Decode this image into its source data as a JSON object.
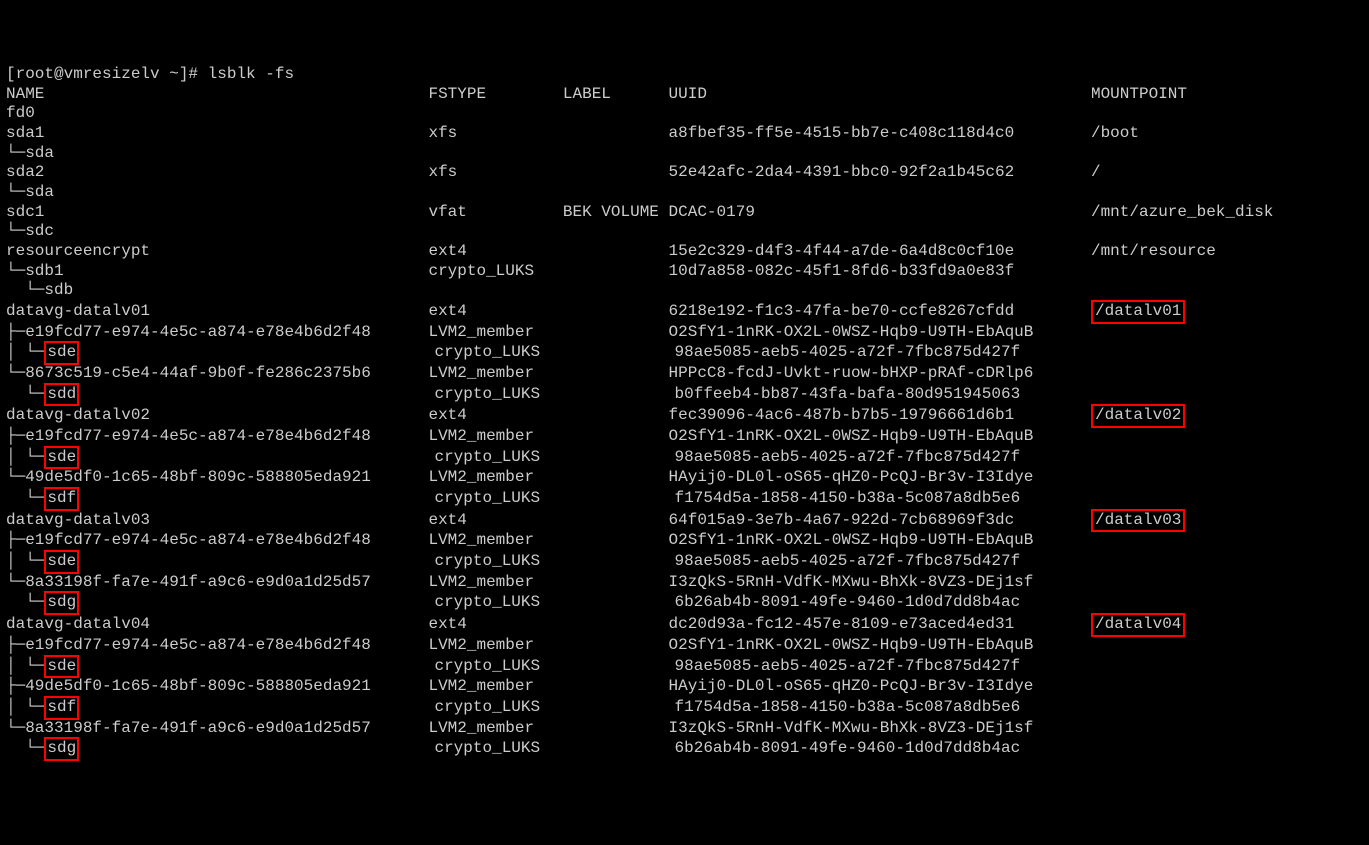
{
  "prompt": "[root@vmresizelv ~]# lsblk -fs",
  "hdr": {
    "name": "NAME",
    "fstype": "FSTYPE",
    "label": "LABEL",
    "uuid": "UUID",
    "mountpoint": "MOUNTPOINT"
  },
  "rows": [
    {
      "name": "fd0"
    },
    {
      "name": "sda1",
      "fstype": "xfs",
      "uuid": "a8fbef35-ff5e-4515-bb7e-c408c118d4c0",
      "mountpoint": "/boot"
    },
    {
      "name": "└─sda"
    },
    {
      "name": "sda2",
      "fstype": "xfs",
      "uuid": "52e42afc-2da4-4391-bbc0-92f2a1b45c62",
      "mountpoint": "/"
    },
    {
      "name": "└─sda"
    },
    {
      "name": "sdc1",
      "fstype": "vfat",
      "label": "BEK VOLUME",
      "uuid": "DCAC-0179",
      "mountpoint": "/mnt/azure_bek_disk"
    },
    {
      "name": "└─sdc"
    },
    {
      "name": "resourceencrypt",
      "fstype": "ext4",
      "uuid": "15e2c329-d4f3-4f44-a7de-6a4d8c0cf10e",
      "mountpoint": "/mnt/resource"
    },
    {
      "name": "└─sdb1",
      "fstype": "crypto_LUKS",
      "uuid": "10d7a858-082c-45f1-8fd6-b33fd9a0e83f"
    },
    {
      "name": "  └─sdb"
    },
    {
      "name": "datavg-datalv01",
      "fstype": "ext4",
      "uuid": "6218e192-f1c3-47fa-be70-ccfe8267cfdd",
      "mountpoint": "/datalv01",
      "hlmp": true
    },
    {
      "name": "├─e19fcd77-e974-4e5c-a874-e78e4b6d2f48",
      "fstype": "LVM2_member",
      "uuid": "O2SfY1-1nRK-OX2L-0WSZ-Hqb9-U9TH-EbAquB"
    },
    {
      "name": "│ └─sde",
      "fstype": "crypto_LUKS",
      "uuid": "98ae5085-aeb5-4025-a72f-7fbc875d427f",
      "hlname": "sde",
      "pre": "│ └─"
    },
    {
      "name": "└─8673c519-c5e4-44af-9b0f-fe286c2375b6",
      "fstype": "LVM2_member",
      "uuid": "HPPcC8-fcdJ-Uvkt-ruow-bHXP-pRAf-cDRlp6"
    },
    {
      "name": "  └─sdd",
      "fstype": "crypto_LUKS",
      "uuid": "b0ffeeb4-bb87-43fa-bafa-80d951945063",
      "hlname": "sdd",
      "pre": "  └─"
    },
    {
      "name": "datavg-datalv02",
      "fstype": "ext4",
      "uuid": "fec39096-4ac6-487b-b7b5-19796661d6b1",
      "mountpoint": "/datalv02",
      "hlmp": true
    },
    {
      "name": "├─e19fcd77-e974-4e5c-a874-e78e4b6d2f48",
      "fstype": "LVM2_member",
      "uuid": "O2SfY1-1nRK-OX2L-0WSZ-Hqb9-U9TH-EbAquB"
    },
    {
      "name": "│ └─sde",
      "fstype": "crypto_LUKS",
      "uuid": "98ae5085-aeb5-4025-a72f-7fbc875d427f",
      "hlname": "sde",
      "pre": "│ └─"
    },
    {
      "name": "└─49de5df0-1c65-48bf-809c-588805eda921",
      "fstype": "LVM2_member",
      "uuid": "HAyij0-DL0l-oS65-qHZ0-PcQJ-Br3v-I3Idye"
    },
    {
      "name": "  └─sdf",
      "fstype": "crypto_LUKS",
      "uuid": "f1754d5a-1858-4150-b38a-5c087a8db5e6",
      "hlname": "sdf",
      "pre": "  └─"
    },
    {
      "name": "datavg-datalv03",
      "fstype": "ext4",
      "uuid": "64f015a9-3e7b-4a67-922d-7cb68969f3dc",
      "mountpoint": "/datalv03",
      "hlmp": true
    },
    {
      "name": "├─e19fcd77-e974-4e5c-a874-e78e4b6d2f48",
      "fstype": "LVM2_member",
      "uuid": "O2SfY1-1nRK-OX2L-0WSZ-Hqb9-U9TH-EbAquB"
    },
    {
      "name": "│ └─sde",
      "fstype": "crypto_LUKS",
      "uuid": "98ae5085-aeb5-4025-a72f-7fbc875d427f",
      "hlname": "sde",
      "pre": "│ └─"
    },
    {
      "name": "└─8a33198f-fa7e-491f-a9c6-e9d0a1d25d57",
      "fstype": "LVM2_member",
      "uuid": "I3zQkS-5RnH-VdfK-MXwu-BhXk-8VZ3-DEj1sf"
    },
    {
      "name": "  └─sdg",
      "fstype": "crypto_LUKS",
      "uuid": "6b26ab4b-8091-49fe-9460-1d0d7dd8b4ac",
      "hlname": "sdg",
      "pre": "  └─"
    },
    {
      "name": "datavg-datalv04",
      "fstype": "ext4",
      "uuid": "dc20d93a-fc12-457e-8109-e73aced4ed31",
      "mountpoint": "/datalv04",
      "hlmp": true
    },
    {
      "name": "├─e19fcd77-e974-4e5c-a874-e78e4b6d2f48",
      "fstype": "LVM2_member",
      "uuid": "O2SfY1-1nRK-OX2L-0WSZ-Hqb9-U9TH-EbAquB"
    },
    {
      "name": "│ └─sde",
      "fstype": "crypto_LUKS",
      "uuid": "98ae5085-aeb5-4025-a72f-7fbc875d427f",
      "hlname": "sde",
      "pre": "│ └─"
    },
    {
      "name": "├─49de5df0-1c65-48bf-809c-588805eda921",
      "fstype": "LVM2_member",
      "uuid": "HAyij0-DL0l-oS65-qHZ0-PcQJ-Br3v-I3Idye"
    },
    {
      "name": "│ └─sdf",
      "fstype": "crypto_LUKS",
      "uuid": "f1754d5a-1858-4150-b38a-5c087a8db5e6",
      "hlname": "sdf",
      "pre": "│ └─"
    },
    {
      "name": "└─8a33198f-fa7e-491f-a9c6-e9d0a1d25d57",
      "fstype": "LVM2_member",
      "uuid": "I3zQkS-5RnH-VdfK-MXwu-BhXk-8VZ3-DEj1sf"
    },
    {
      "name": "  └─sdg",
      "fstype": "crypto_LUKS",
      "uuid": "6b26ab4b-8091-49fe-9460-1d0d7dd8b4ac",
      "hlname": "sdg",
      "pre": "  └─"
    }
  ],
  "cols": {
    "name": 44,
    "fstype": 14,
    "label": 11,
    "uuid": 44
  }
}
